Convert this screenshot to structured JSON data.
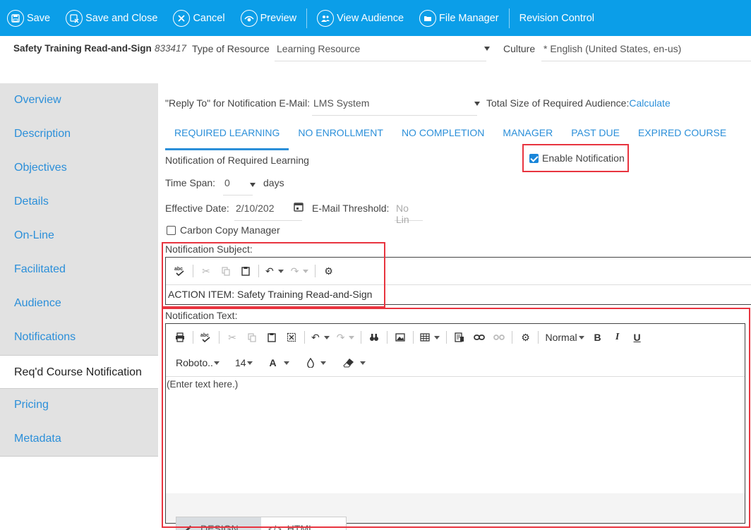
{
  "toolbar": {
    "save": "Save",
    "save_close": "Save and Close",
    "cancel": "Cancel",
    "preview": "Preview",
    "view_audience": "View Audience",
    "file_manager": "File Manager",
    "revision_control": "Revision Control"
  },
  "header": {
    "title": "Safety Training Read-and-Sign",
    "id": "833417",
    "type_label": "Type of Resource",
    "type_value": "Learning Resource",
    "culture_label": "Culture",
    "culture_value": "* English (United States, en-us)"
  },
  "sidebar": {
    "items": [
      {
        "label": "Overview"
      },
      {
        "label": "Description"
      },
      {
        "label": "Objectives"
      },
      {
        "label": "Details"
      },
      {
        "label": "On-Line"
      },
      {
        "label": "Facilitated"
      },
      {
        "label": "Audience"
      },
      {
        "label": "Notifications"
      },
      {
        "label": "Req'd Course Notification"
      },
      {
        "label": "Pricing"
      },
      {
        "label": "Metadata"
      }
    ],
    "active_index": 8
  },
  "main": {
    "reply_to_label": "\"Reply To\" for Notification E-Mail:",
    "reply_to_value": "LMS System",
    "audience_size_label": "Total Size of Required Audience:",
    "calculate_link": "Calculate",
    "tabs": [
      {
        "label": "REQUIRED LEARNING"
      },
      {
        "label": "NO ENROLLMENT"
      },
      {
        "label": "NO COMPLETION"
      },
      {
        "label": "MANAGER"
      },
      {
        "label": "PAST DUE"
      },
      {
        "label": "EXPIRED COURSE"
      }
    ],
    "section_title": "Notification of Required Learning",
    "enable_notification_label": "Enable Notification",
    "enable_notification_checked": true,
    "time_span_label": "Time Span:",
    "time_span_value": "0",
    "time_span_unit": "days",
    "effective_date_label": "Effective Date:",
    "effective_date_value": "2/10/202",
    "email_threshold_label": "E-Mail Threshold:",
    "email_threshold_placeholder": "No Lin",
    "carbon_copy_label": "Carbon Copy Manager",
    "carbon_copy_checked": false,
    "subject_label": "Notification Subject:",
    "subject_value": "ACTION ITEM:  Safety Training Read-and-Sign",
    "text_label": "Notification Text:",
    "text_placeholder": "(Enter text here.)",
    "editor": {
      "paragraph_format": "Normal",
      "font_name": "Roboto..",
      "font_size": "14",
      "bold": "B",
      "italic": "I",
      "underline": "U",
      "font_color": "A"
    },
    "mode_tabs": {
      "design": "DESIGN",
      "html": "HTML",
      "active": "design"
    }
  },
  "colors": {
    "toolbar_bg": "#0b9ee8",
    "link": "#2b8fd9",
    "highlight_box": "#e8343f",
    "sidebar_bg": "#e2e2e2"
  }
}
